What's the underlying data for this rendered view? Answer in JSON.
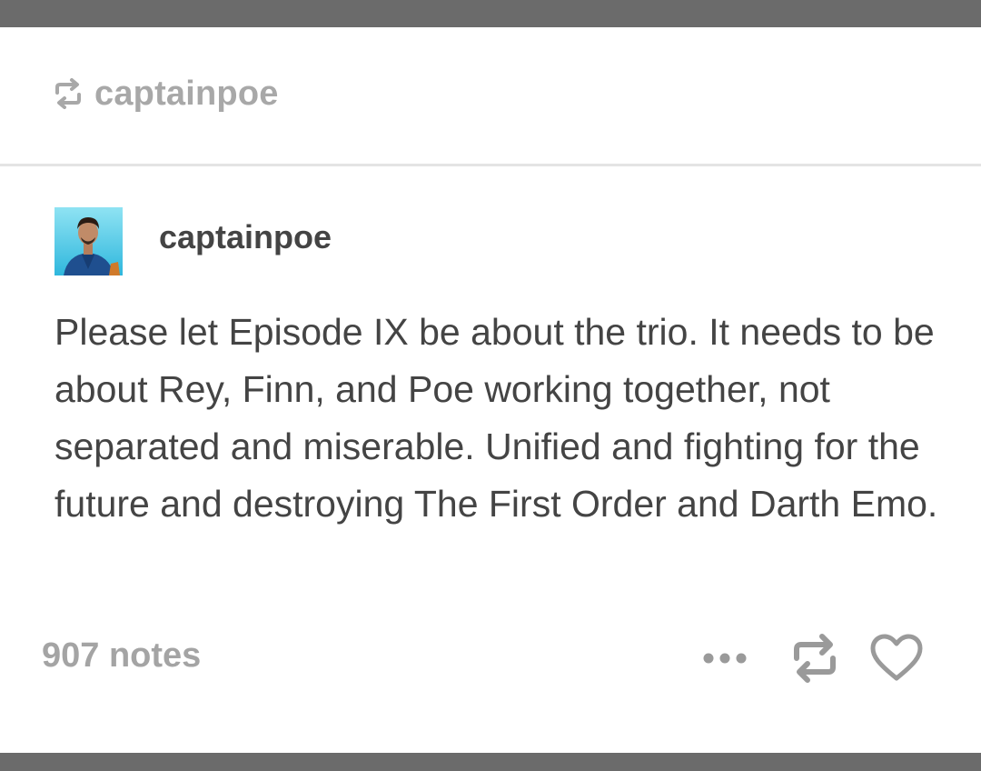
{
  "reblog_header": {
    "username": "captainpoe",
    "icon": "reblog-icon"
  },
  "post": {
    "author": "captainpoe",
    "avatar_icon": "avatar-photo",
    "body": "Please let Episode IX be about the trio. It needs to be about Rey, Finn, and Poe working together, not separated and miserable. Unified and fighting for the future and destroying The First Order and Darth Emo."
  },
  "footer": {
    "notes": "907 notes",
    "actions": [
      {
        "name": "more",
        "icon": "ellipsis-icon"
      },
      {
        "name": "reblog",
        "icon": "reblog-icon"
      },
      {
        "name": "like",
        "icon": "heart-icon"
      }
    ]
  },
  "colors": {
    "frame_bar": "#6b6b6b",
    "muted_text": "#a8a8a8",
    "body_text": "#444444",
    "divider": "#e4e4e4",
    "icon_gray": "#9a9a9a",
    "avatar_bg": "#3fc2e2"
  }
}
